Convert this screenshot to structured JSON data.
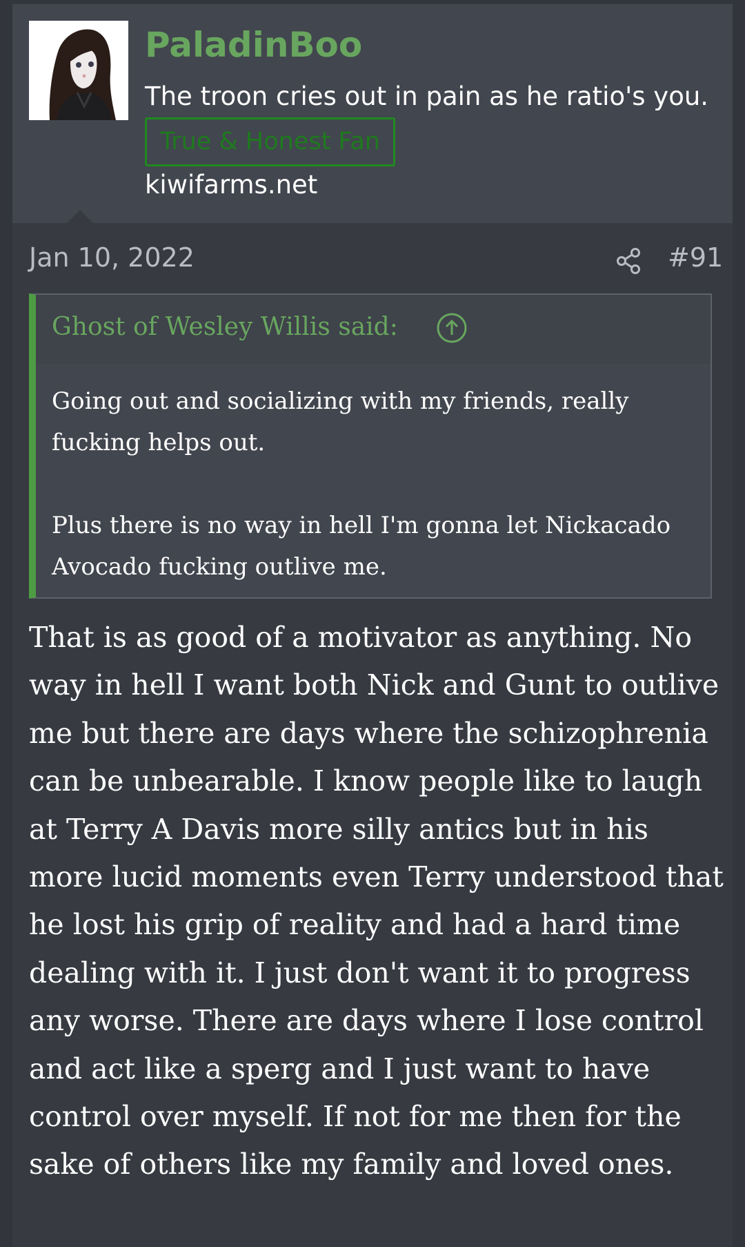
{
  "post": {
    "user": {
      "name": "PaladinBoo",
      "title": "The troon cries out in pain as he ratio's you.",
      "badge": "True & Honest Fan",
      "site": "kiwifarms.net",
      "avatar_icon": "avatar-illustration-icon"
    },
    "date": "Jan 10, 2022",
    "number": "#91",
    "share_icon": "share-icon",
    "quote": {
      "author": "Ghost of Wesley Willis said:",
      "up_icon": "arrow-up-circle-icon",
      "paragraphs": [
        "Going out and socializing with my friends, really fucking helps out.",
        "Plus there is no way in hell I'm gonna let Nickacado Avocado fucking outlive me."
      ]
    },
    "body": "That is as good of a motivator as anything. No way in hell I want both Nick and Gunt to outlive me but there are days where the schizophrenia can be unbearable. I know people like to laugh at Terry A Davis more silly antics but in his more lucid moments even Terry understood that he lost his grip of reality and had a hard time dealing with it. I just don't want it to progress any worse. There are days where I lose control and act like a sperg and I just want to have control over myself. If not for me then for the sake of others like my family and loved ones."
  },
  "colors": {
    "page_bg": "#32353b",
    "post_bg": "#373a41",
    "user_block_bg": "#42464e",
    "accent_green": "#68a65f",
    "quote_bar": "#4e9d44",
    "badge_border": "#1f8a1f",
    "meta_text": "#b9bcc2"
  }
}
